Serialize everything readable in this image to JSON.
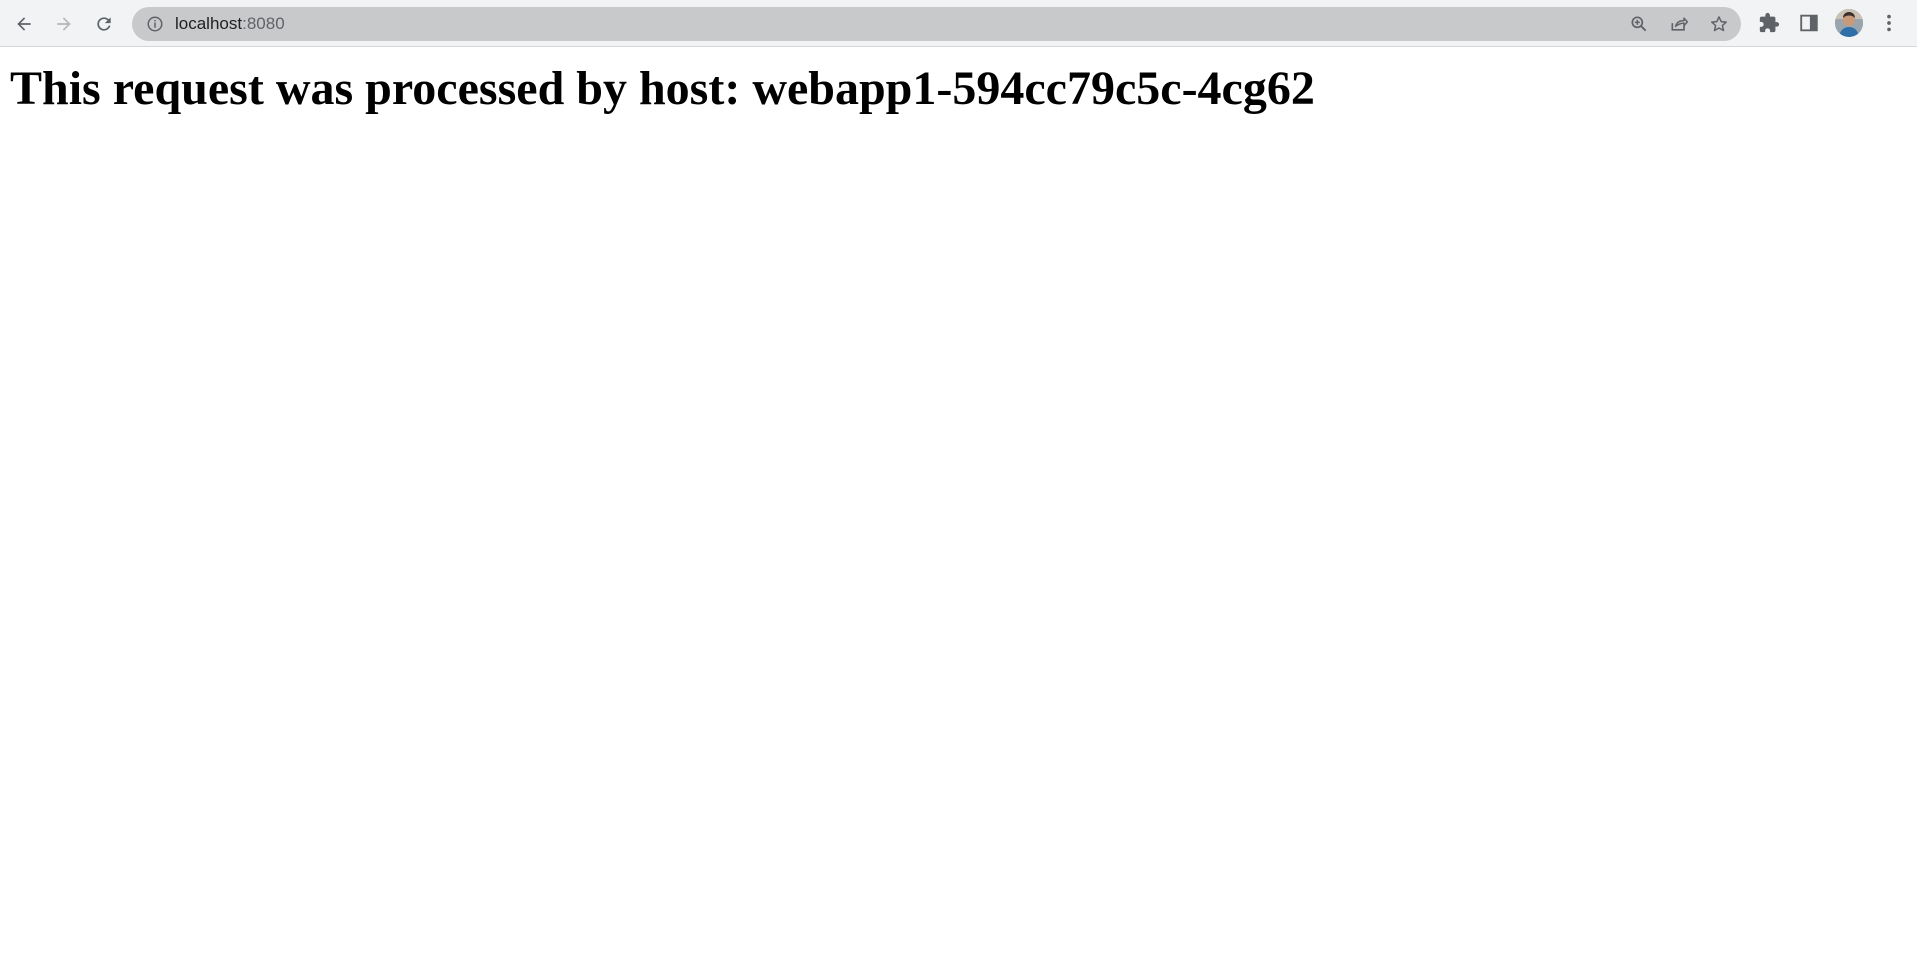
{
  "browser": {
    "url_host": "localhost",
    "url_port": ":8080",
    "icons": {
      "back": "back-arrow-icon",
      "forward": "forward-arrow-icon",
      "reload": "reload-icon",
      "site_info": "info-icon",
      "zoom": "zoom-icon",
      "share": "share-icon",
      "bookmark": "star-icon",
      "extensions": "puzzle-icon",
      "side_panel": "side-panel-icon",
      "profile": "avatar",
      "menu": "kebab-menu-icon"
    },
    "colors": {
      "toolbar_bg": "#f1f3f4",
      "omnibox_bg": "#c8c9cb",
      "icon": "#5f6368"
    }
  },
  "page": {
    "heading": "This request was processed by host: webapp1-594cc79c5c-4cg62"
  }
}
